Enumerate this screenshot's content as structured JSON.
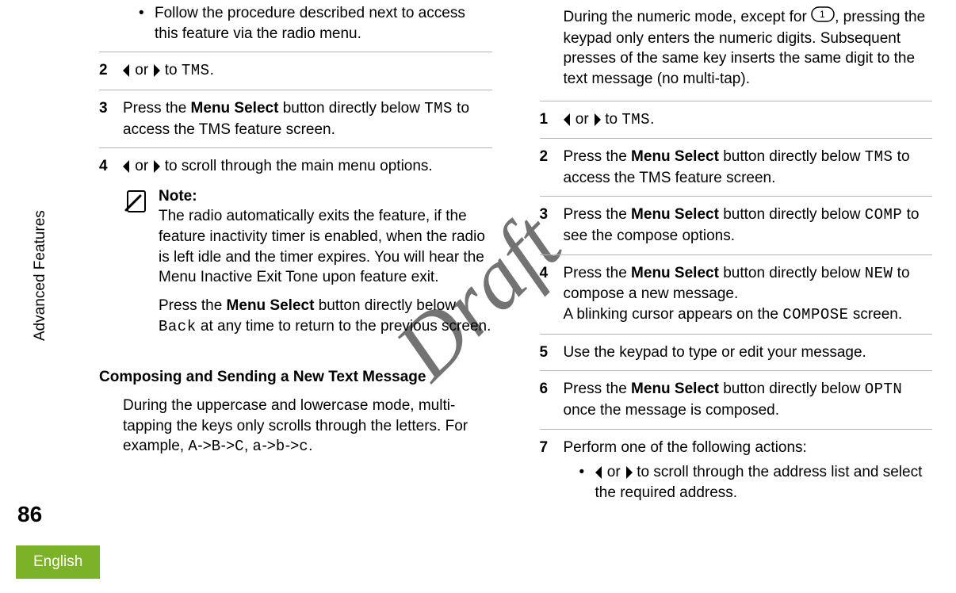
{
  "watermark": "Draft",
  "sideLabel": "Advanced Features",
  "pageNumber": "86",
  "languageTab": "English",
  "left": {
    "bullet1": "Follow the procedure described next to access this feature via the radio menu.",
    "step2_num": "2",
    "step2_or": " or ",
    "step2_to": " to ",
    "step2_tms": "TMS",
    "step2_dot": ".",
    "step3_num": "3",
    "step3_a": "Press the ",
    "step3_b": "Menu Select",
    "step3_c": " button directly below ",
    "step3_tms": "TMS",
    "step3_d": " to access the TMS feature screen.",
    "step4_num": "4",
    "step4_or": " or ",
    "step4_txt": " to scroll through the main menu options.",
    "note_title": "Note:",
    "note_p1": "The radio automatically exits the feature, if the feature inactivity timer is enabled, when the radio is left idle and the timer expires. You will hear the Menu Inactive Exit Tone upon feature exit.",
    "note_p2_a": "Press the ",
    "note_p2_b": "Menu Select",
    "note_p2_c": " button directly below ",
    "note_p2_back": "Back",
    "note_p2_d": " at any time to return to the previous screen.",
    "heading": "Composing and Sending a New Text Message",
    "para_a": "During the uppercase and lowercase mode, multi-tapping the keys only scrolls through the letters. For example, ",
    "para_seq1": "A",
    "para_arrow": "->",
    "para_seq2": "B",
    "para_seq3": "C",
    "para_comma": ", ",
    "para_seq4": "a",
    "para_seq5": "b",
    "para_seq6": "c",
    "para_dot": "."
  },
  "right": {
    "intro_a": "During the numeric mode, except for ",
    "intro_b": ", pressing the keypad only enters the numeric digits. Subsequent presses of the same key inserts the same digit to the text message (no multi-tap).",
    "s1_num": "1",
    "s1_or": " or ",
    "s1_to": " to ",
    "s1_tms": "TMS",
    "s1_dot": ".",
    "s2_num": "2",
    "s2_a": "Press the ",
    "s2_b": "Menu Select",
    "s2_c": " button directly below ",
    "s2_tms": "TMS",
    "s2_d": " to access the TMS feature screen.",
    "s3_num": "3",
    "s3_a": "Press the ",
    "s3_b": "Menu Select",
    "s3_c": " button directly below ",
    "s3_comp": "COMP",
    "s3_d": " to see the compose options.",
    "s4_num": "4",
    "s4_a": "Press the ",
    "s4_b": "Menu Select",
    "s4_c": " button directly below ",
    "s4_new": "NEW",
    "s4_d": " to compose a new message.",
    "s4_e": "A blinking cursor appears on the ",
    "s4_compose": "COMPOSE",
    "s4_f": " screen.",
    "s5_num": "5",
    "s5_txt": "Use the keypad to type or edit your message.",
    "s6_num": "6",
    "s6_a": "Press the ",
    "s6_b": "Menu Select",
    "s6_c": " button directly below ",
    "s6_optn": "OPTN",
    "s6_d": " once the message is composed.",
    "s7_num": "7",
    "s7_txt": "Perform one of the following actions:",
    "s7_bullet_or": " or ",
    "s7_bullet_txt": " to scroll through the address list and select the required address."
  }
}
